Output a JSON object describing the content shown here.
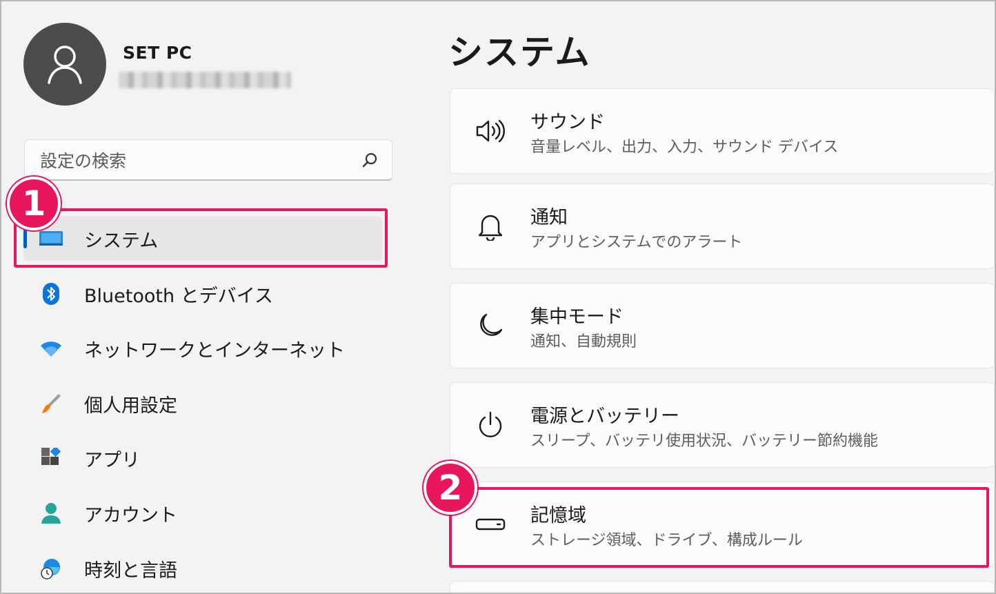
{
  "user": {
    "name": "SET PC"
  },
  "search": {
    "placeholder": "設定の検索"
  },
  "sidebar": {
    "items": [
      {
        "label": "システム",
        "icon": "system-icon",
        "active": true
      },
      {
        "label": "Bluetooth とデバイス",
        "icon": "bluetooth-icon"
      },
      {
        "label": "ネットワークとインターネット",
        "icon": "wifi-icon"
      },
      {
        "label": "個人用設定",
        "icon": "paintbrush-icon"
      },
      {
        "label": "アプリ",
        "icon": "apps-icon"
      },
      {
        "label": "アカウント",
        "icon": "account-icon"
      },
      {
        "label": "時刻と言語",
        "icon": "time-language-icon"
      }
    ]
  },
  "main": {
    "title": "システム",
    "cards": [
      {
        "title": "サウンド",
        "subtitle": "音量レベル、出力、入力、サウンド デバイス",
        "icon": "speaker-icon"
      },
      {
        "title": "通知",
        "subtitle": "アプリとシステムでのアラート",
        "icon": "bell-icon"
      },
      {
        "title": "集中モード",
        "subtitle": "通知、自動規則",
        "icon": "moon-icon"
      },
      {
        "title": "電源とバッテリー",
        "subtitle": "スリープ、バッテリ使用状況、バッテリー節約機能",
        "icon": "power-icon"
      },
      {
        "title": "記憶域",
        "subtitle": "ストレージ領域、ドライブ、構成ルール",
        "icon": "storage-icon"
      }
    ]
  },
  "annotations": {
    "step1": "1",
    "step2": "2",
    "highlight_color": "#e8175d"
  },
  "colors": {
    "accent": "#005fb8",
    "bluetooth": "#0a74d9"
  }
}
